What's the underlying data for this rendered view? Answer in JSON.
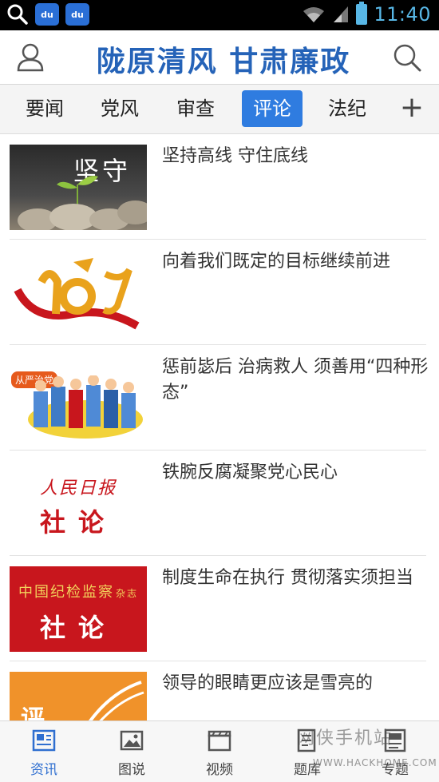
{
  "status_bar": {
    "time": "11:40",
    "icons": [
      "search-icon",
      "baidu-paw-icon",
      "baidu-paw-icon",
      "wifi-icon",
      "signal-icon",
      "battery-icon"
    ],
    "paw_label": "du"
  },
  "header": {
    "title": "陇原清风  甘肃廉政",
    "left_icon": "user-icon",
    "right_icon": "search-icon",
    "title_color": "#2563b8"
  },
  "tabs": {
    "items": [
      {
        "label": "要闻"
      },
      {
        "label": "党风"
      },
      {
        "label": "审查"
      },
      {
        "label": "评论"
      },
      {
        "label": "法纪"
      }
    ],
    "active_index": 3,
    "add_label": "+",
    "accent": "#2f7ce0"
  },
  "news": [
    {
      "title": "坚持高线 守住底线",
      "thumb_text": "坚守"
    },
    {
      "title": "向着我们既定的目标继续前进",
      "thumb_text": "10"
    },
    {
      "title": "惩前毖后 治病救人 须善用“四种形态”",
      "thumb_text": "从严治党"
    },
    {
      "title": "铁腕反腐凝聚党心民心",
      "thumb_brand": "人民日报",
      "thumb_text": "社论"
    },
    {
      "title": "制度生命在执行 贯彻落实须担当",
      "thumb_brand": "中国纪检监察",
      "thumb_brand_sub": "杂志",
      "thumb_text": "社论"
    },
    {
      "title": "领导的眼睛更应该是雪亮的",
      "thumb_text": "评"
    }
  ],
  "bottom_nav": {
    "items": [
      {
        "label": "资讯",
        "icon": "news-icon"
      },
      {
        "label": "图说",
        "icon": "picture-icon"
      },
      {
        "label": "视频",
        "icon": "video-icon"
      },
      {
        "label": "题库",
        "icon": "question-bank-icon"
      },
      {
        "label": "专题",
        "icon": "topic-icon"
      }
    ],
    "active_index": 0
  },
  "watermark": {
    "text": "网侠手机站",
    "sub": "WWW.HACKHOME.COM"
  }
}
